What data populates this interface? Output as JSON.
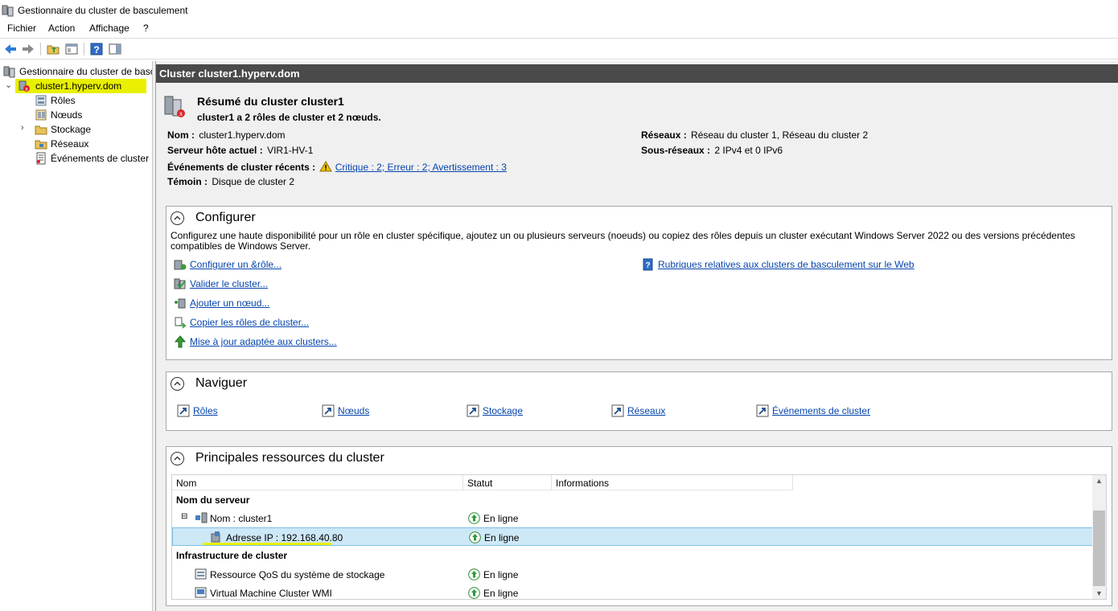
{
  "window": {
    "title": "Gestionnaire du cluster de basculement"
  },
  "menu": [
    "Fichier",
    "Action",
    "Affichage",
    "?"
  ],
  "tree": {
    "root": "Gestionnaire du cluster de basc",
    "cluster": "cluster1.hyperv.dom",
    "items": [
      "Rôles",
      "Nœuds",
      "Stockage",
      "Réseaux",
      "Événements de cluster"
    ]
  },
  "header": {
    "title": "Cluster cluster1.hyperv.dom"
  },
  "summary": {
    "title": "Résumé du cluster cluster1",
    "subtitle": "cluster1 a 2 rôles de cluster et 2 nœuds.",
    "name_label": "Nom :",
    "name_value": "cluster1.hyperv.dom",
    "host_label": "Serveur hôte actuel :",
    "host_value": "VIR1-HV-1",
    "events_label": "Événements de cluster récents :",
    "events_value": "Critique : 2; Erreur : 2; Avertissement : 3",
    "witness_label": "Témoin :",
    "witness_value": "Disque de cluster 2",
    "networks_label": "Réseaux :",
    "networks_value": "Réseau du cluster 1, Réseau du cluster 2",
    "subnets_label": "Sous-réseaux :",
    "subnets_value": "2 IPv4 et 0 IPv6"
  },
  "configure": {
    "title": "Configurer",
    "description": "Configurez une haute disponibilité pour un rôle en cluster spécifique, ajoutez un ou plusieurs serveurs (noeuds) ou copiez des rôles depuis un cluster exécutant Windows Server 2022 ou des versions précédentes compatibles de Windows Server.",
    "links": [
      "Configurer un &rôle...",
      "Valider le cluster...",
      "Ajouter un nœud...",
      "Copier les rôles de cluster...",
      "Mise à jour adaptée aux clusters..."
    ],
    "help_link": "Rubriques relatives aux clusters de basculement sur le Web"
  },
  "navigate": {
    "title": "Naviguer",
    "links": [
      "Rôles",
      "Nœuds ",
      "Stockage",
      "Réseaux",
      "Événements de cluster"
    ]
  },
  "resources": {
    "title": "Principales ressources du cluster",
    "columns": [
      "Nom",
      "Statut",
      "Informations"
    ],
    "group_server": "Nom du serveur",
    "group_infra": "Infrastructure de cluster",
    "rows": [
      {
        "name": "Nom : cluster1",
        "status": "En ligne"
      },
      {
        "name": "Adresse IP : 192.168.40.80",
        "status": "En ligne"
      },
      {
        "name": "Ressource QoS du système de stockage",
        "status": "En ligne"
      },
      {
        "name": "Virtual Machine Cluster WMI",
        "status": "En ligne"
      }
    ]
  },
  "colors": {
    "highlight": "#e8f000",
    "link": "#0645ad",
    "header": "#4a4a4a",
    "selection": "#cde8f7"
  }
}
